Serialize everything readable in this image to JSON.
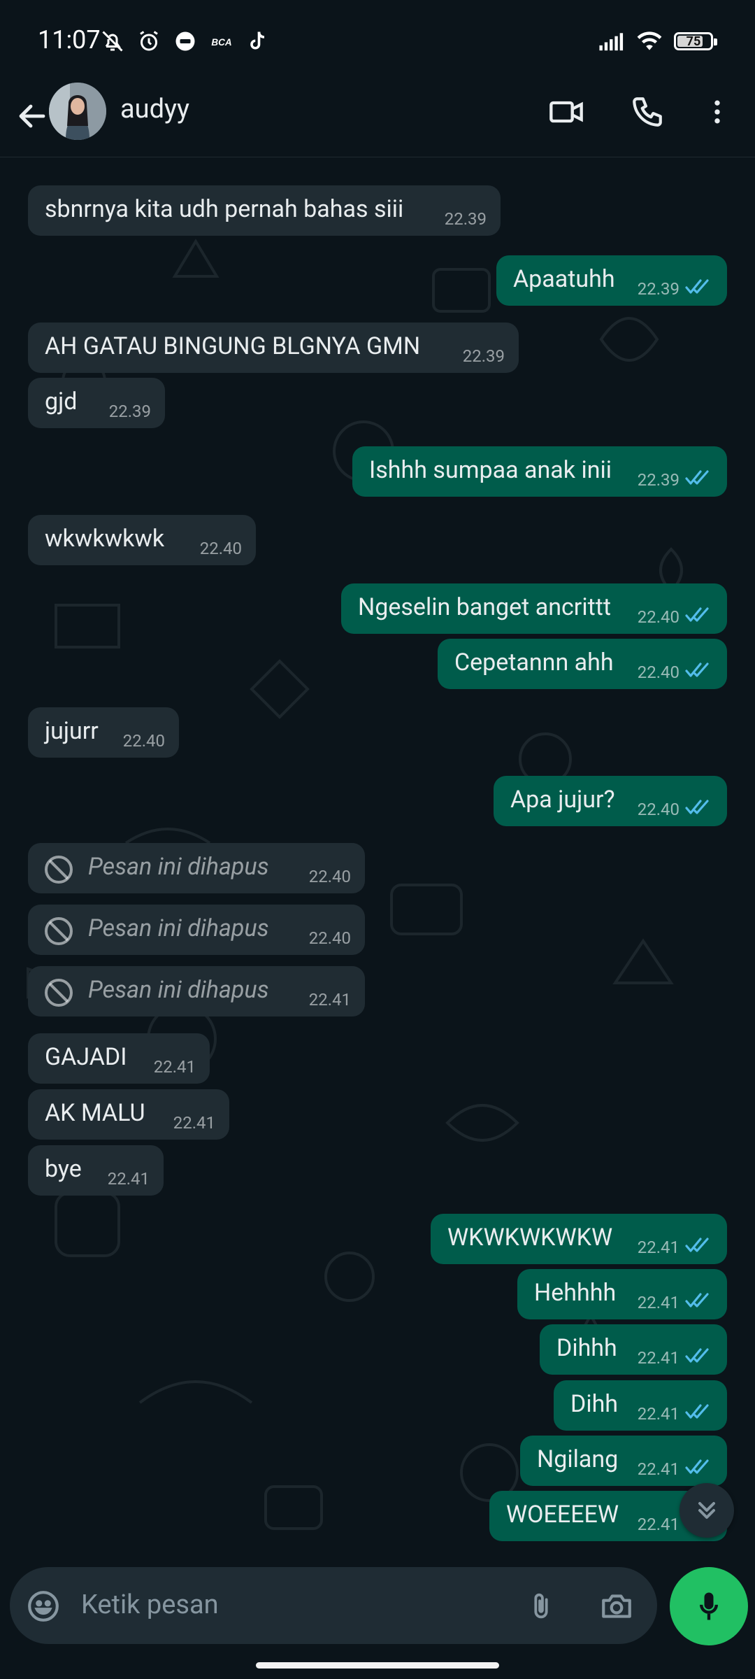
{
  "status_bar": {
    "time": "11:07",
    "battery": "75",
    "left_icons": [
      "mute-icon",
      "alarm-icon",
      "notification-icon",
      "bca-icon",
      "tiktok-icon"
    ],
    "right_icons": [
      "signal-icon",
      "wifi-icon",
      "battery-icon"
    ]
  },
  "header": {
    "contact_name": "audyy",
    "icons": [
      "back-arrow-icon",
      "video-call-icon",
      "voice-call-icon",
      "more-options-icon"
    ]
  },
  "colors": {
    "background": "#0b141a",
    "incoming_bubble": "#202c33",
    "outgoing_bubble": "#005c4b",
    "read_ticks": "#53bdeb",
    "mic_button": "#21c063"
  },
  "messages": [
    {
      "dir": "in",
      "text": "sbnrnya kita udh pernah bahas siii",
      "time": "22.39"
    },
    {
      "dir": "out",
      "text": "Apaatuhh",
      "time": "22.39"
    },
    {
      "dir": "in",
      "text": "AH GATAU BINGUNG BLGNYA GMN",
      "time": "22.39"
    },
    {
      "dir": "in",
      "text": "gjd",
      "time": "22.39"
    },
    {
      "dir": "out",
      "text": "Ishhh sumpaa anak inii",
      "time": "22.39"
    },
    {
      "dir": "in",
      "text": "wkwkwkwk",
      "time": "22.40"
    },
    {
      "dir": "out",
      "text": "Ngeselin banget ancrittt",
      "time": "22.40"
    },
    {
      "dir": "out",
      "text": "Cepetannn ahh",
      "time": "22.40"
    },
    {
      "dir": "in",
      "text": "jujurr",
      "time": "22.40"
    },
    {
      "dir": "out",
      "text": "Apa jujur?",
      "time": "22.40"
    },
    {
      "dir": "in",
      "text": "Pesan ini dihapus",
      "time": "22.40",
      "deleted": true
    },
    {
      "dir": "in",
      "text": "Pesan ini dihapus",
      "time": "22.40",
      "deleted": true
    },
    {
      "dir": "in",
      "text": "Pesan ini dihapus",
      "time": "22.41",
      "deleted": true
    },
    {
      "dir": "in",
      "text": "GAJADI",
      "time": "22.41"
    },
    {
      "dir": "in",
      "text": "AK MALU",
      "time": "22.41"
    },
    {
      "dir": "in",
      "text": "bye",
      "time": "22.41"
    },
    {
      "dir": "out",
      "text": "WKWKWKWKW",
      "time": "22.41"
    },
    {
      "dir": "out",
      "text": "Hehhhh",
      "time": "22.41"
    },
    {
      "dir": "out",
      "text": "Dihhh",
      "time": "22.41"
    },
    {
      "dir": "out",
      "text": "Dihh",
      "time": "22.41"
    },
    {
      "dir": "out",
      "text": "Ngilang",
      "time": "22.41"
    },
    {
      "dir": "out",
      "text": "WOEEEEW",
      "time": "22.41"
    }
  ],
  "input": {
    "placeholder": "Ketik pesan"
  }
}
